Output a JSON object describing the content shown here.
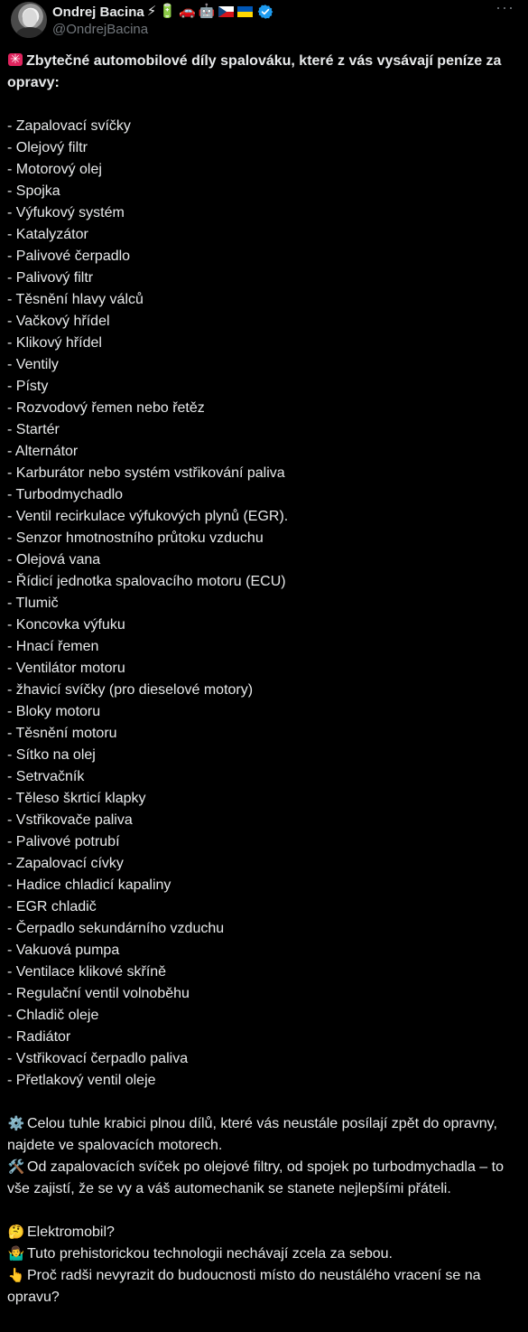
{
  "author": {
    "display_name": "Ondrej Bacina",
    "handle": "@OndrejBacina",
    "badges": [
      "⚡",
      "🔋",
      "🚗",
      "🤖"
    ],
    "flags": [
      "cz-flag",
      "ua-flag"
    ]
  },
  "post": {
    "heading": "Zbytečné automobilové díly spalováku, které z vás vysávají peníze za opravy:",
    "parts": [
      "- Zapalovací svíčky",
      "- Olejový filtr",
      "- Motorový olej",
      "- Spojka",
      "- Výfukový systém",
      "- Katalyzátor",
      "- Palivové čerpadlo",
      "- Palivový filtr",
      "- Těsnění hlavy válců",
      "- Vačkový hřídel",
      "- Klikový hřídel",
      "- Ventily",
      "- Písty",
      "- Rozvodový řemen nebo řetěz",
      "- Startér",
      "- Alternátor",
      "- Karburátor nebo systém vstřikování paliva",
      "- Turbodmychadlo",
      "- Ventil recirkulace výfukových plynů (EGR).",
      "- Senzor hmotnostního průtoku vzduchu",
      "- Olejová vana",
      "- Řídicí jednotka spalovacího motoru (ECU)",
      "- Tlumič",
      "- Koncovka výfuku",
      "- Hnací řemen",
      "- Ventilátor motoru",
      "- žhavicí svíčky (pro dieselové motory)",
      "- Bloky motoru",
      "- Těsnění motoru",
      "- Sítko na olej",
      "- Setrvačník",
      "- Těleso škrticí klapky",
      "- Vstřikovače paliva",
      "- Palivové potrubí",
      "- Zapalovací cívky",
      "- Hadice chladicí kapaliny",
      "- EGR chladič",
      "- Čerpadlo sekundárního vzduchu",
      "- Vakuová pumpa",
      "- Ventilace klikové skříně",
      "- Regulační ventil volnoběhu",
      "- Chladič oleje",
      "- Radiátor",
      "- Vstřikovací čerpadlo paliva",
      "- Přetlakový ventil oleje"
    ],
    "paragraph_gear": "Celou tuhle krabici plnou dílů, které vás neustále posílají zpět do opravny, najdete ve spalovacích motorech.",
    "paragraph_tools": "Od zapalovacích svíček po olejové filtry, od spojek po turbodmychadla – to vše zajistí, že se vy a váš automechanik se stanete nejlepšími přáteli.",
    "line_question": "Elektromobil?",
    "line_person": "Tuto prehistorickou technologii nechávají zcela za sebou.",
    "line_point": "Proč radši nevyrazit do budoucnosti místo do neustálého vracení se na opravu?"
  },
  "icons": {
    "gear": "⚙️",
    "tools": "🛠️",
    "thinking": "🤔",
    "person": "🤷‍♂️",
    "point_up": "👆"
  },
  "colors": {
    "background": "#000000",
    "text": "#e7e9ea",
    "secondary": "#71767b",
    "verified": "#1d9bf0"
  }
}
